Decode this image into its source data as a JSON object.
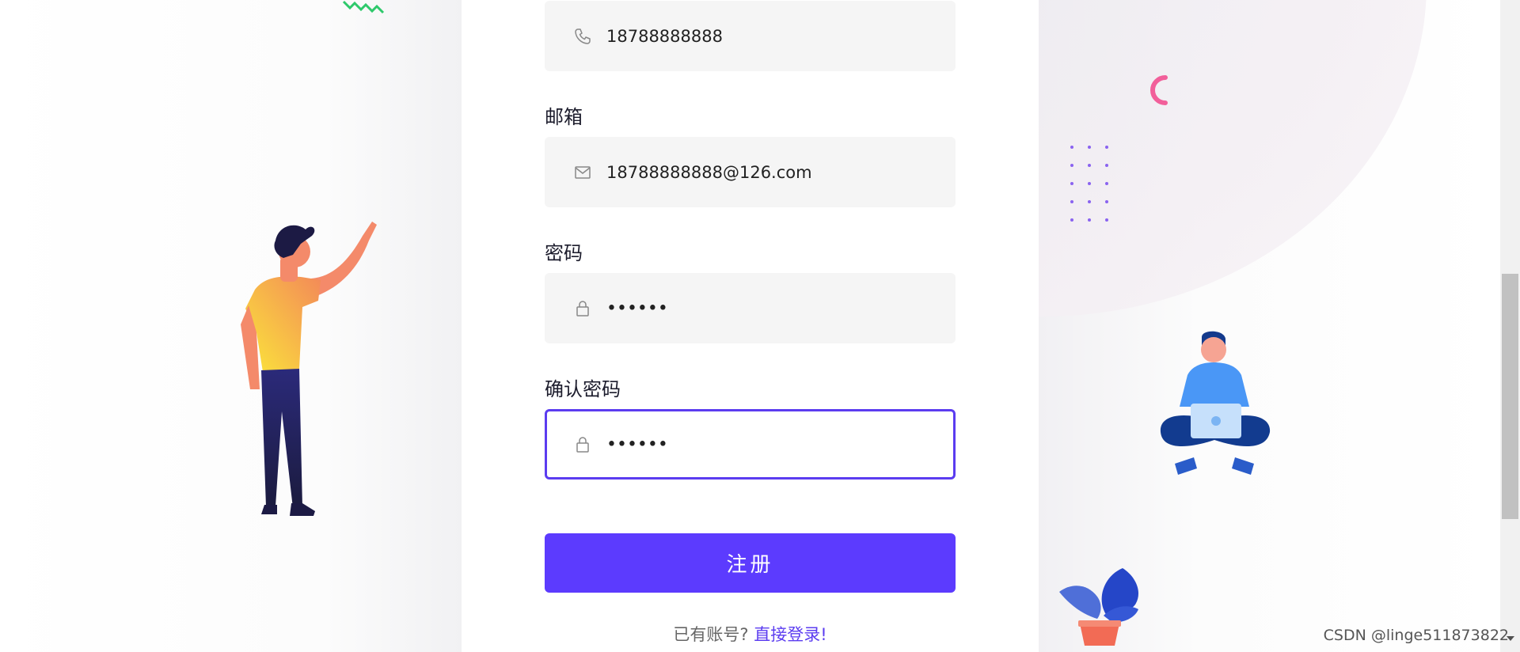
{
  "form": {
    "phone": {
      "value": "18788888888",
      "icon": "phone-icon"
    },
    "email": {
      "label": "邮箱",
      "value": "18788888888@126.com",
      "icon": "mail-icon"
    },
    "password": {
      "label": "密码",
      "value": "••••••",
      "icon": "lock-icon"
    },
    "confirm_password": {
      "label": "确认密码",
      "value": "••••••",
      "icon": "lock-icon"
    },
    "submit_label": "注册",
    "login_prompt": "已有账号?",
    "login_link": "直接登录!"
  },
  "watermark": "CSDN @linge511873822",
  "colors": {
    "accent": "#5c3bfe",
    "field_bg": "#f5f5f5",
    "link": "#5b3cf0"
  }
}
